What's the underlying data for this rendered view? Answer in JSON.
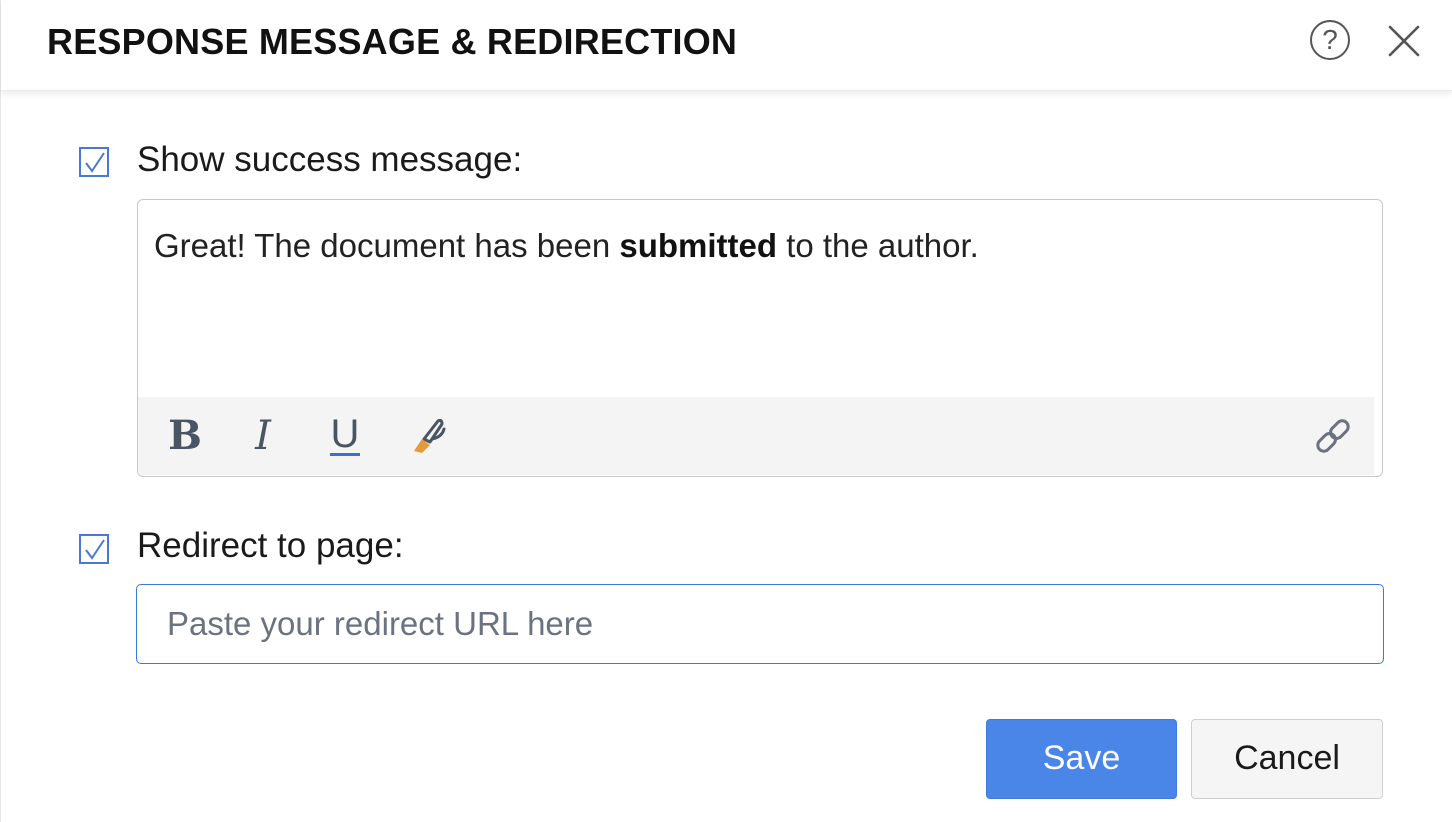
{
  "dialog": {
    "title": "RESPONSE MESSAGE & REDIRECTION",
    "help_icon": "question-circle-icon",
    "help_glyph": "?",
    "close_icon": "close-icon"
  },
  "success_message": {
    "checked": true,
    "label": "Show success message:",
    "text_before": "Great! The document has been ",
    "text_bold": "submitted",
    "text_after": " to the author.",
    "toolbar": {
      "bold_glyph": "B",
      "italic_glyph": "I",
      "underline_glyph": "U",
      "format_icon": "paint-brush-icon",
      "link_icon": "link-icon"
    }
  },
  "redirect": {
    "checked": true,
    "label": "Redirect to page:",
    "value": "",
    "placeholder": "Paste your redirect URL here"
  },
  "actions": {
    "save_label": "Save",
    "cancel_label": "Cancel"
  },
  "colors": {
    "accent": "#4a86e8",
    "checkbox": "#4a78d6",
    "input_focus_border": "#3b79d9",
    "toolbar_bg": "#f4f4f5"
  }
}
